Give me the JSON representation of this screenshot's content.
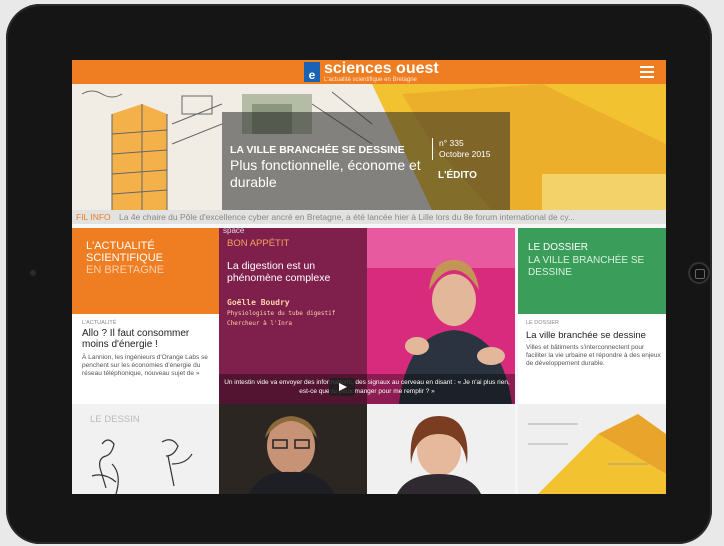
{
  "app": {
    "brand": "sciences ouest",
    "tagline": "L'actualité scientifique en Bretagne",
    "logo_letter": "e"
  },
  "hero": {
    "title": "LA VILLE BRANCHÉE SE DESSINE",
    "subtitle": "Plus fonctionnelle, économe et durable",
    "issue_number": "n° 335",
    "issue_date": "Octobre 2015",
    "edito": "L'ÉDITO"
  },
  "fil_info": {
    "label": "FIL INFO",
    "text": "La 4e chaire du Pôle d'excellence cyber ancré en Bretagne, a été lancée hier à Lille lors du 8e forum international de cy..."
  },
  "actualite": {
    "line1": "L'ACTUALITÉ",
    "line2": "SCIENTIFIQUE",
    "line3": "EN BRETAGNE",
    "kicker": "L'ACTUALITÉ",
    "title": "Allo ? Il faut consommer moins d'énergie !",
    "desc": "À Lannion, les ingénieurs d'Orange Labs se penchent sur les économies d'énergie du réseau téléphonique, nouveau sujet de »"
  },
  "dessin": {
    "label": "LE DESSIN"
  },
  "video": {
    "badge": "space",
    "kicker": "BON APPÉTIT",
    "title": "La digestion est un phénomène complexe",
    "name": "Goëlle Boudry",
    "role1": "Physiologiste du tube digestif",
    "role2": "Chercheur à l'Inra",
    "caption": "Un intestin vide va envoyer des informations, des signaux au cerveau en disant : « Je n'ai plus rien, est-ce que tu peux manger pour me remplir ? »"
  },
  "dossier": {
    "line1": "LE DOSSIER",
    "line2": "LA VILLE BRANCHÉE SE DESSINE",
    "kicker": "LE DOSSIER",
    "title": "La ville branchée se dessine",
    "desc": "Villes et bâtiments s'interconnectent pour faciliter la vie urbaine et répondre à des enjeux de développement durable."
  },
  "colors": {
    "orange": "#ef7d22",
    "green": "#3a9d5a",
    "magenta": "#c2206d",
    "plum": "#7f1f4c",
    "blue": "#1a62b3"
  }
}
